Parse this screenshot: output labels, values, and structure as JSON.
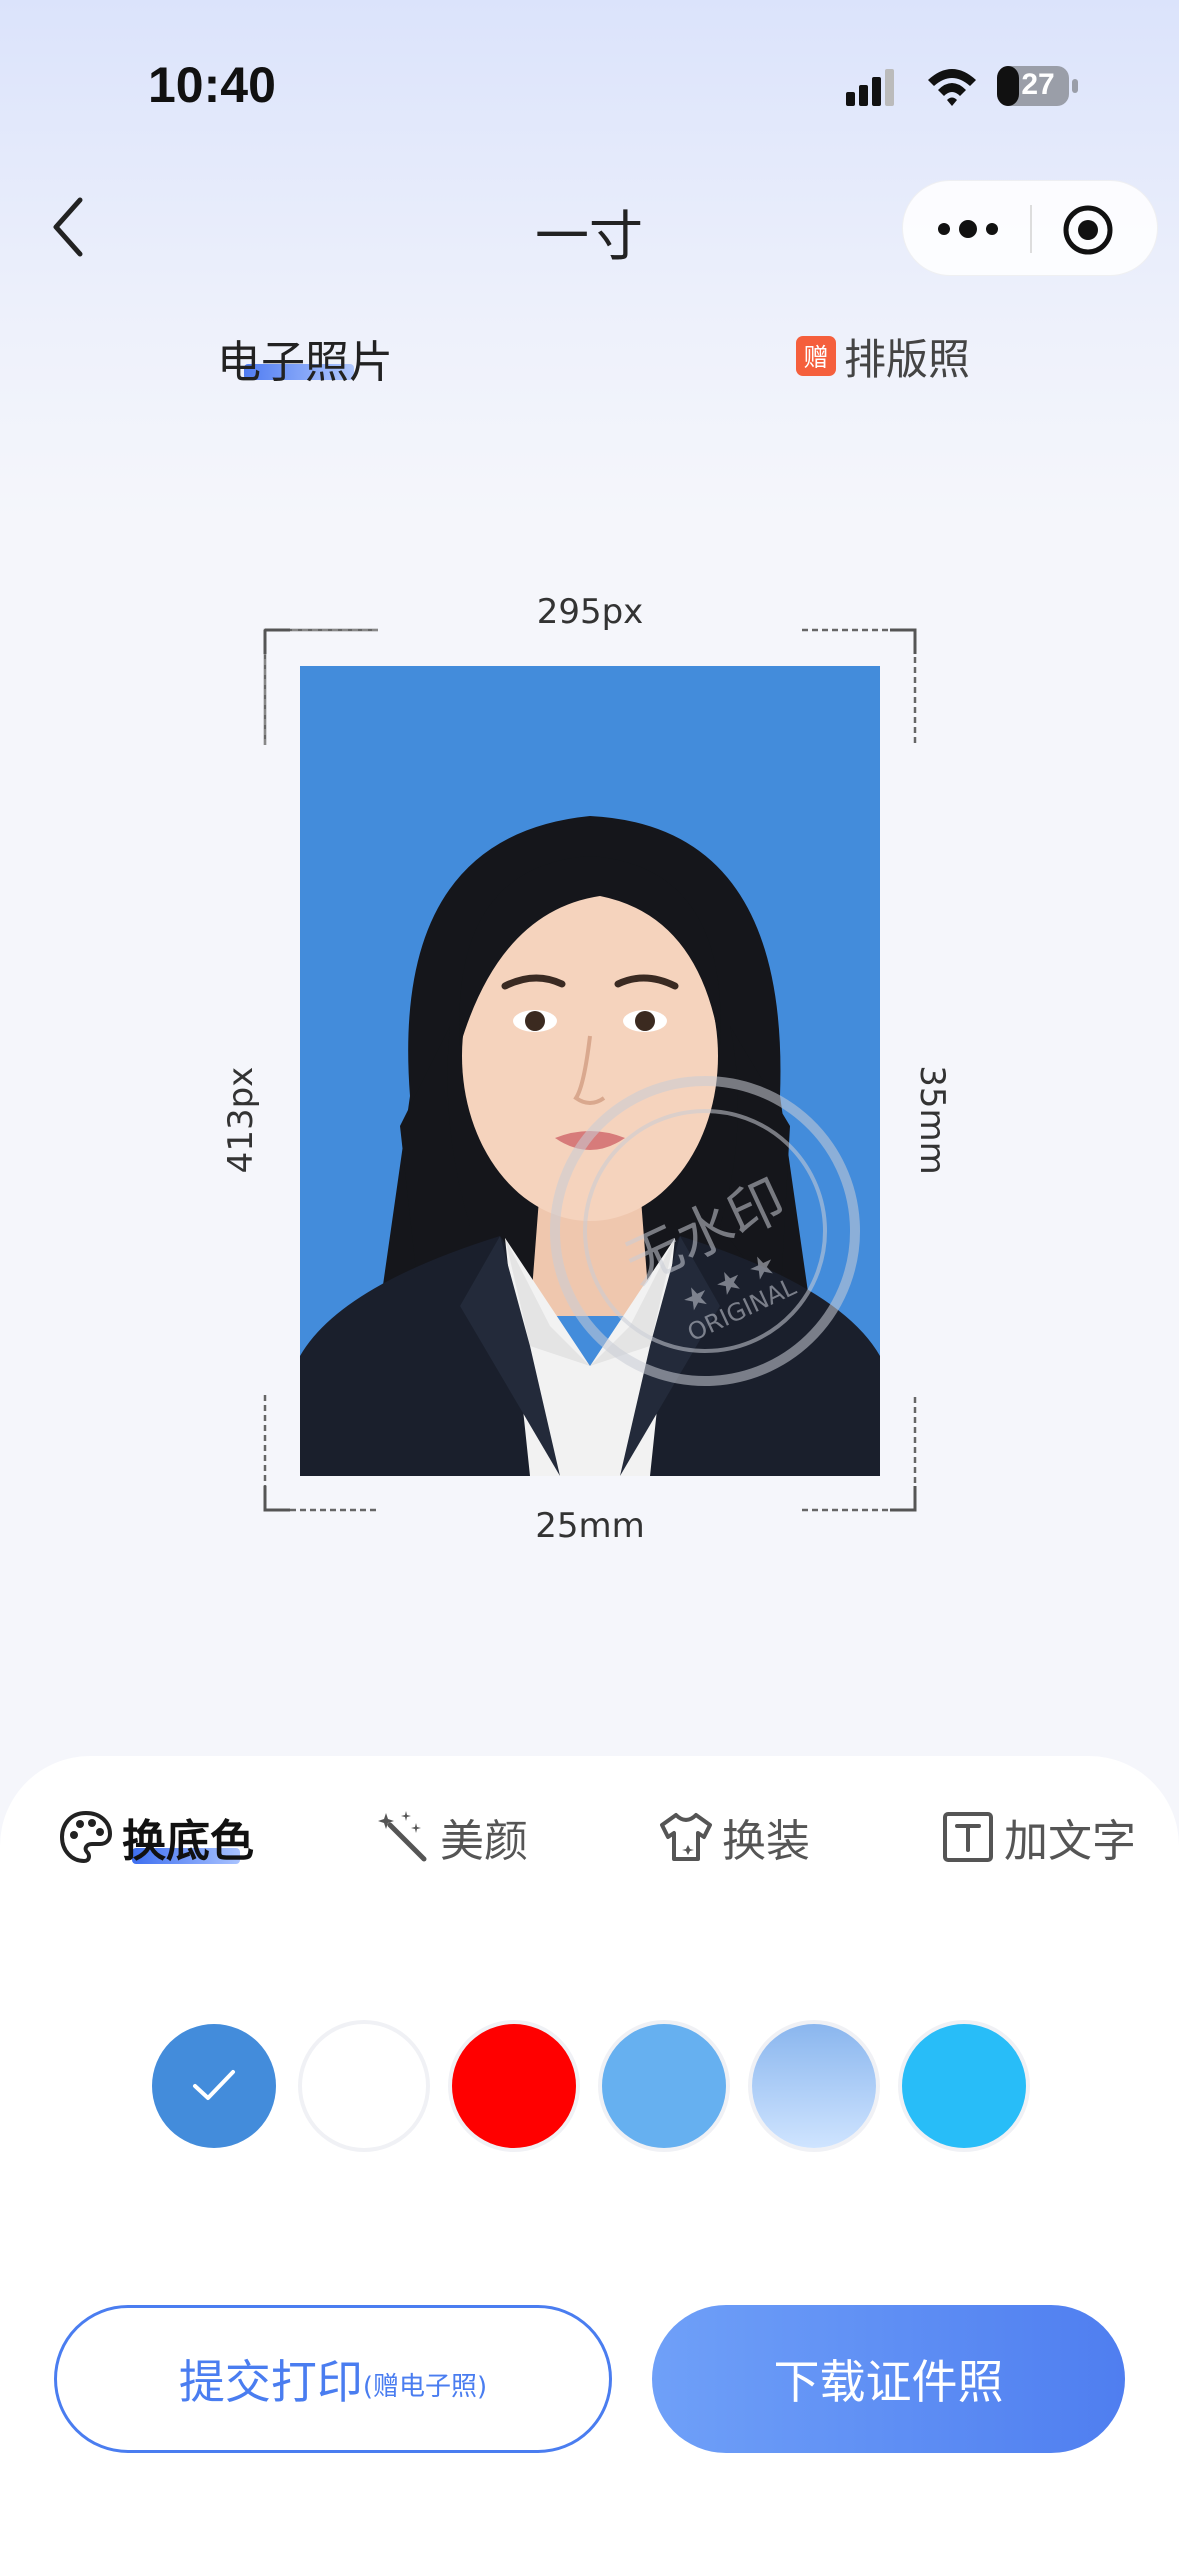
{
  "status_bar": {
    "time": "10:40",
    "battery_level": "27"
  },
  "nav": {
    "title": "一寸"
  },
  "tabs": {
    "electronic_label": "电子照片",
    "layout_label": "排版照",
    "gift_badge": "赠"
  },
  "preview": {
    "width_px": "295px",
    "height_px": "413px",
    "width_mm": "25mm",
    "height_mm": "35mm",
    "background_color": "#438cdb",
    "watermark_text": "无水印",
    "watermark_sub": "ORIGINAL"
  },
  "tools": [
    {
      "label": "换底色",
      "icon": "palette-icon",
      "active": true
    },
    {
      "label": "美颜",
      "icon": "magic-wand-icon",
      "active": false
    },
    {
      "label": "换装",
      "icon": "shirt-icon",
      "active": false
    },
    {
      "label": "加文字",
      "icon": "text-box-icon",
      "active": false
    }
  ],
  "colors": [
    {
      "name": "blue",
      "hex": "#438cdb",
      "selected": true
    },
    {
      "name": "white",
      "hex": "#ffffff",
      "selected": false
    },
    {
      "name": "red",
      "hex": "#ff0000",
      "selected": false
    },
    {
      "name": "light-blue",
      "hex": "#66b0f0",
      "selected": false
    },
    {
      "name": "gradient-blue",
      "hex": "#90bbf0",
      "selected": false
    },
    {
      "name": "sky-blue",
      "hex": "#28bdf8",
      "selected": false
    }
  ],
  "actions": {
    "print_label": "提交打印",
    "print_sub": "(赠电子照)",
    "download_label": "下载证件照",
    "accent": "#4a7df0"
  }
}
